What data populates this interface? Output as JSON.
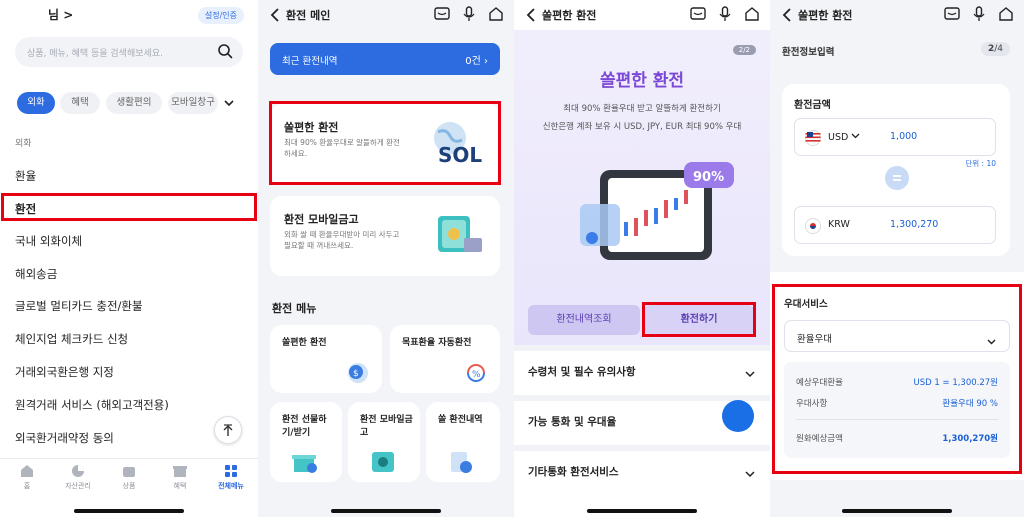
{
  "panel1": {
    "user_suffix": "님 >",
    "settings_label": "설정/인증",
    "search_placeholder": "상품, 메뉴, 혜택 등을 검색해보세요.",
    "chips": [
      {
        "label": "외화",
        "active": true
      },
      {
        "label": "혜택",
        "active": false
      },
      {
        "label": "생활편의",
        "active": false
      },
      {
        "label": "모바일창구",
        "active": false
      }
    ],
    "section_label": "외화",
    "menu_items": [
      "환율",
      "환전",
      "국내 외화이체",
      "해외송금",
      "글로벌 멀티카드 충전/환불",
      "체인지업 체크카드 신청",
      "거래외국환은행 지정",
      "원격거래 서비스 (해외고객전용)",
      "외국환거래약정 동의"
    ],
    "tabs": [
      {
        "label": "홈",
        "active": false
      },
      {
        "label": "자산관리",
        "active": false
      },
      {
        "label": "상품",
        "active": false
      },
      {
        "label": "혜택",
        "active": false
      },
      {
        "label": "전체메뉴",
        "active": true
      }
    ]
  },
  "panel2": {
    "title": "환전 메인",
    "recent_label": "최근 환전내역",
    "recent_count": "0건",
    "card1": {
      "title": "쏠편한 환전",
      "desc": "최대 90% 환율우대로 알뜰하게 환전하세요."
    },
    "card2": {
      "title": "환전 모바일금고",
      "desc": "외화 쌀 때 환율우대받아 미리 사두고 필요할 때 꺼내쓰세요."
    },
    "menu_heading": "환전 메뉴",
    "menu": [
      "쏠편한 환전",
      "목표환율 자동환전",
      "환전 선물하기/받기",
      "환전 모바일금고",
      "쏠 환전내역"
    ],
    "sol_logo": "SOL"
  },
  "panel3": {
    "title": "쏠편한 환전",
    "page_indicator": "2/2",
    "hero_title": "쏠편한 환전",
    "hero_desc1": "최대 90% 환율우대 받고 알뜰하게 환전하기",
    "hero_desc2": "신한은행 계좌 보유 시 USD, JPY, EUR 최대 90% 우대",
    "badge": "90%",
    "btn_history": "환전내역조회",
    "btn_exchange": "환전하기",
    "sections": [
      "수령처 및 필수 유의사항",
      "가능 통화 및 우대율",
      "기타통화 환전서비스"
    ]
  },
  "panel4": {
    "title": "쏠편한 환전",
    "step_label": "환전정보입력",
    "step_current": "2",
    "step_total": "/4",
    "amount_title": "환전금액",
    "from_currency": "USD",
    "from_value": "1,000",
    "unit": "단위 : 10",
    "to_currency": "KRW",
    "to_value": "1,300,270",
    "pref_title": "우대서비스",
    "pref_select": "환율우대",
    "rows": [
      {
        "k": "예상우대환율",
        "v": "USD 1 = 1,300.27원"
      },
      {
        "k": "우대사항",
        "v": "환율우대 90 %"
      },
      {
        "k": "원화예상금액",
        "v": "1,300,270원"
      }
    ]
  },
  "colors": {
    "accent": "#2d6be0",
    "highlight": "#e60012",
    "purple": "#7b49d6"
  }
}
